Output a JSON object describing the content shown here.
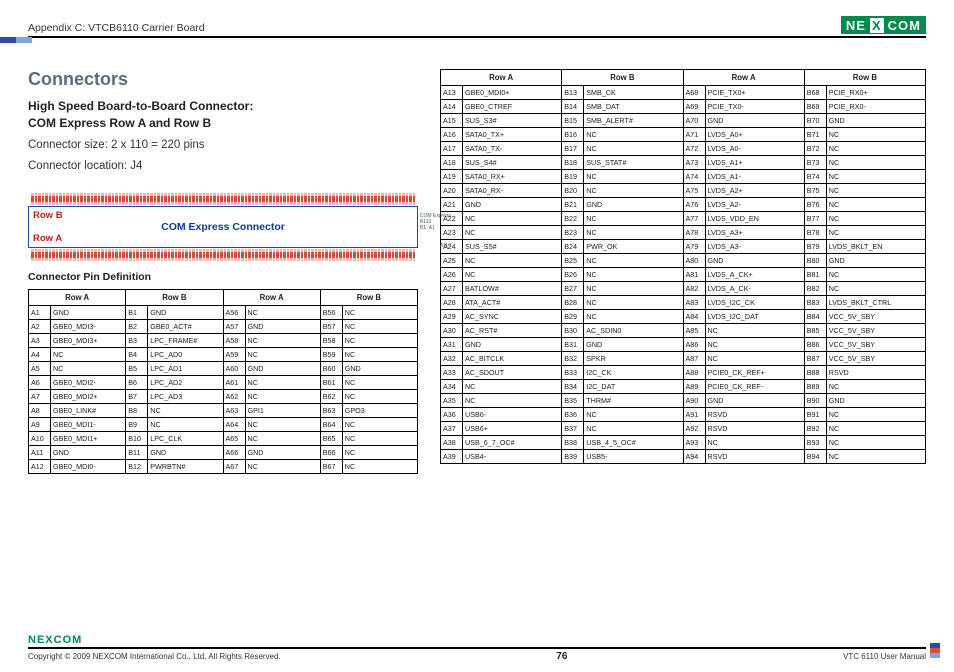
{
  "header": {
    "breadcrumb": "Appendix C: VTCB6110 Carrier Board",
    "brand": {
      "pre": "NE",
      "x": "X",
      "post": "COM"
    }
  },
  "page": {
    "title": "Connectors",
    "subhead_l1": "High Speed Board-to-Board Connector:",
    "subhead_l2": "COM Express Row A and Row B",
    "meta_l1": "Connector size: 2 x 110 = 220 pins",
    "meta_l2": "Connector location: J4",
    "diagram": {
      "row_b": "Row B",
      "row_a": "Row A",
      "center": "COM Express Connector"
    },
    "pin_def_head": "Connector Pin Definition",
    "col_headers": {
      "rowa": "Row A",
      "rowb": "Row B"
    }
  },
  "table_left": [
    [
      "A1",
      "GND",
      "B1",
      "GND",
      "A56",
      "NC",
      "B56",
      "NC"
    ],
    [
      "A2",
      "GBE0_MDI3-",
      "B2",
      "GBE0_ACT#",
      "A57",
      "GND",
      "B57",
      "NC"
    ],
    [
      "A3",
      "GBE0_MDI3+",
      "B3",
      "LPC_FRAME#",
      "A58",
      "NC",
      "B58",
      "NC"
    ],
    [
      "A4",
      "NC",
      "B4",
      "LPC_AD0",
      "A59",
      "NC",
      "B59",
      "NC"
    ],
    [
      "A5",
      "NC",
      "B5",
      "LPC_AD1",
      "A60",
      "GND",
      "B60",
      "GND"
    ],
    [
      "A6",
      "GBE0_MDI2-",
      "B6",
      "LPC_AD2",
      "A61",
      "NC",
      "B61",
      "NC"
    ],
    [
      "A7",
      "GBE0_MDI2+",
      "B7",
      "LPC_AD3",
      "A62",
      "NC",
      "B62",
      "NC"
    ],
    [
      "A8",
      "GBE0_LINK#",
      "B8",
      "NC",
      "A63",
      "GPI1",
      "B63",
      "GPO3"
    ],
    [
      "A9",
      "GBE0_MDI1-",
      "B9",
      "NC",
      "A64",
      "NC",
      "B64",
      "NC"
    ],
    [
      "A10",
      "GBE0_MDI1+",
      "B10",
      "LPC_CLK",
      "A65",
      "NC",
      "B65",
      "NC"
    ],
    [
      "A11",
      "GND",
      "B11",
      "GND",
      "A66",
      "GND",
      "B66",
      "NC"
    ],
    [
      "A12",
      "GBE0_MDI0-",
      "B12",
      "PWRBTN#",
      "A67",
      "NC",
      "B67",
      "NC"
    ]
  ],
  "table_right": [
    [
      "A13",
      "GBE0_MDI0+",
      "B13",
      "SMB_CK",
      "A68",
      "PCIE_TX0+",
      "B68",
      "PCIE_RX0+"
    ],
    [
      "A14",
      "GBE0_CTREF",
      "B14",
      "SMB_DAT",
      "A69",
      "PCIE_TX0-",
      "B69",
      "PCIE_RX0-"
    ],
    [
      "A15",
      "SUS_S3#",
      "B15",
      "SMB_ALERT#",
      "A70",
      "GND",
      "B70",
      "GND"
    ],
    [
      "A16",
      "SATA0_TX+",
      "B16",
      "NC",
      "A71",
      "LVDS_A0+",
      "B71",
      "NC"
    ],
    [
      "A17",
      "SATA0_TX-",
      "B17",
      "NC",
      "A72",
      "LVDS_A0-",
      "B72",
      "NC"
    ],
    [
      "A18",
      "SUS_S4#",
      "B18",
      "SUS_STAT#",
      "A73",
      "LVDS_A1+",
      "B73",
      "NC"
    ],
    [
      "A19",
      "SATA0_RX+",
      "B19",
      "NC",
      "A74",
      "LVDS_A1-",
      "B74",
      "NC"
    ],
    [
      "A20",
      "SATA0_RX-",
      "B20",
      "NC",
      "A75",
      "LVDS_A2+",
      "B75",
      "NC"
    ],
    [
      "A21",
      "GND",
      "B21",
      "GND",
      "A76",
      "LVDS_A2-",
      "B76",
      "NC"
    ],
    [
      "A22",
      "NC",
      "B22",
      "NC",
      "A77",
      "LVDS_VDD_EN",
      "B77",
      "NC"
    ],
    [
      "A23",
      "NC",
      "B23",
      "NC",
      "A78",
      "LVDS_A3+",
      "B78",
      "NC"
    ],
    [
      "A24",
      "SUS_S5#",
      "B24",
      "PWR_OK",
      "A79",
      "LVDS_A3-",
      "B79",
      "LVDS_BKLT_EN"
    ],
    [
      "A25",
      "NC",
      "B25",
      "NC",
      "A80",
      "GND",
      "B80",
      "GND"
    ],
    [
      "A26",
      "NC",
      "B26",
      "NC",
      "A81",
      "LVDS_A_CK+",
      "B81",
      "NC"
    ],
    [
      "A27",
      "BATLOW#",
      "B27",
      "NC",
      "A82",
      "LVDS_A_CK-",
      "B82",
      "NC"
    ],
    [
      "A28",
      "ATA_ACT#",
      "B28",
      "NC",
      "A83",
      "LVDS_I2C_CK",
      "B83",
      "LVDS_BKLT_CTRL"
    ],
    [
      "A29",
      "AC_SYNC",
      "B29",
      "NC",
      "A84",
      "LVDS_I2C_DAT",
      "B84",
      "VCC_5V_SBY"
    ],
    [
      "A30",
      "AC_RST#",
      "B30",
      "AC_SDIN0",
      "A85",
      "NC",
      "B85",
      "VCC_5V_SBY"
    ],
    [
      "A31",
      "GND",
      "B31",
      "GND",
      "A86",
      "NC",
      "B86",
      "VCC_5V_SBY"
    ],
    [
      "A32",
      "AC_BITCLK",
      "B32",
      "SPKR",
      "A87",
      "NC",
      "B87",
      "VCC_5V_SBY"
    ],
    [
      "A33",
      "AC_SDOUT",
      "B33",
      "I2C_CK",
      "A88",
      "PCIE0_CK_REF+",
      "B88",
      "RSVD"
    ],
    [
      "A34",
      "NC",
      "B34",
      "I2C_DAT",
      "A89",
      "PCIE0_CK_REF-",
      "B89",
      "NC"
    ],
    [
      "A35",
      "NC",
      "B35",
      "THRM#",
      "A90",
      "GND",
      "B90",
      "GND"
    ],
    [
      "A36",
      "USB6-",
      "B36",
      "NC",
      "A91",
      "RSVD",
      "B91",
      "NC"
    ],
    [
      "A37",
      "USB6+",
      "B37",
      "NC",
      "A92",
      "RSVD",
      "B92",
      "NC"
    ],
    [
      "A38",
      "USB_6_7_OC#",
      "B38",
      "USB_4_5_OC#",
      "A93",
      "NC",
      "B93",
      "NC"
    ],
    [
      "A39",
      "USB4-",
      "B39",
      "USB5-",
      "A94",
      "RSVD",
      "B94",
      "NC"
    ]
  ],
  "footer": {
    "copyright": "Copyright © 2009 NEXCOM International Co., Ltd. All Rights Reserved.",
    "page_num": "76",
    "manual": "VTC 6110 User Manual"
  }
}
